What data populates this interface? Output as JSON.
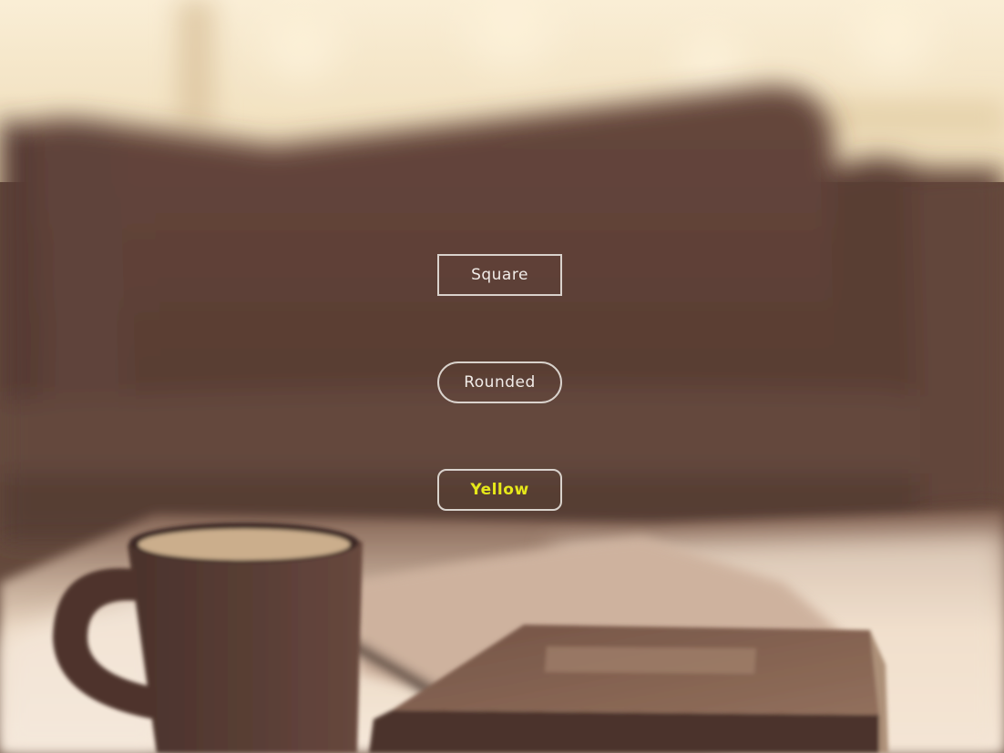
{
  "buttons": {
    "square": {
      "label": "Square"
    },
    "rounded": {
      "label": "Rounded"
    },
    "yellow": {
      "label": "Yellow",
      "text_color": "#e6e81a"
    }
  },
  "colors": {
    "button_border": "#f0ece8",
    "button_text": "#f1ece8",
    "accent_yellow": "#e6e81a"
  }
}
